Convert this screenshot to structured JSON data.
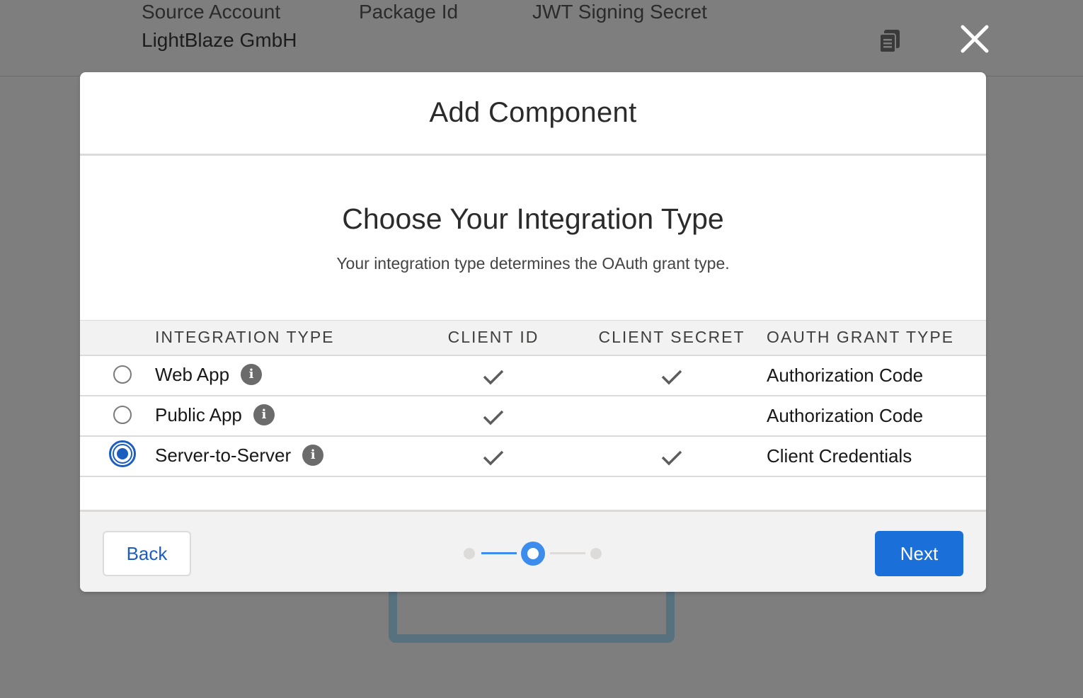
{
  "background": {
    "labels": [
      "Source Account",
      "Package Id",
      "JWT Signing Secret"
    ],
    "source_account_value": "LightBlaze GmbH"
  },
  "modal": {
    "title": "Add Component",
    "heading": "Choose Your Integration Type",
    "subheading": "Your integration type determines the OAuth grant type.",
    "table": {
      "headers": [
        "INTEGRATION TYPE",
        "CLIENT ID",
        "CLIENT SECRET",
        "OAUTH GRANT TYPE"
      ],
      "rows": [
        {
          "name": "Web App",
          "client_id": true,
          "client_secret": true,
          "grant": "Authorization Code",
          "selected": false
        },
        {
          "name": "Public App",
          "client_id": true,
          "client_secret": false,
          "grant": "Authorization Code",
          "selected": false
        },
        {
          "name": "Server-to-Server",
          "client_id": true,
          "client_secret": true,
          "grant": "Client Credentials",
          "selected": true
        }
      ]
    },
    "footer": {
      "back_label": "Back",
      "next_label": "Next",
      "step_current": 2,
      "step_total": 3
    }
  },
  "colors": {
    "brand_blue": "#1b6fd8",
    "radio_blue": "#1b5ebf",
    "step_active": "#3b8cec",
    "overlay": "#7e7e7e"
  },
  "icons": {
    "copy": "copy-icon",
    "close": "close-icon",
    "info": "info-icon",
    "check": "check-icon"
  }
}
